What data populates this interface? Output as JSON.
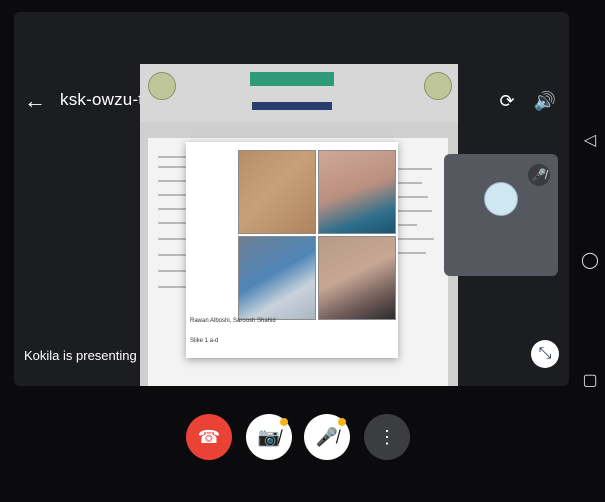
{
  "meeting": {
    "code": "ksk-owzu-tzj",
    "presenting_text": "Kokila is presenting"
  },
  "icons": {
    "back": "arrow-back-icon",
    "switch_camera": "switch-camera-icon",
    "speaker": "speaker-icon",
    "thumb_mic_off": "mic-off-icon",
    "pip": "compress-icon",
    "end_call": "phone-hangup-icon",
    "camera_off": "camera-off-icon",
    "mic_off": "mic-off-icon",
    "more": "more-vert-icon",
    "nav_back": "triangle-back-icon",
    "nav_home": "circle-home-icon",
    "nav_recents": "square-recents-icon"
  },
  "document_preview": {
    "card_caption": "Rawan Alboshi, Saroosh Shahid",
    "card_fig": "Slike 1 a-d"
  },
  "colors": {
    "end_call_red": "#EA4335",
    "badge_yellow": "#F5B51B",
    "stage_bg": "#1B1D20"
  }
}
